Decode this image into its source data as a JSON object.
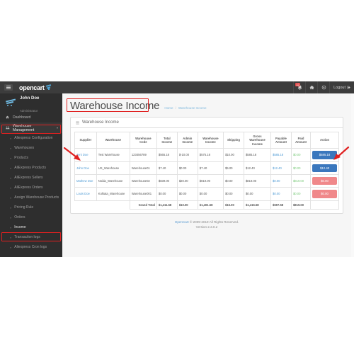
{
  "navbar": {
    "brand": "opencart",
    "toggle_name": "menu-toggle",
    "notifications_badge": "12",
    "logout_label": "Logout"
  },
  "sidebar": {
    "user_name": "John Doe",
    "user_role": "Administrator",
    "items": [
      {
        "label": "Dashboard",
        "icon": "dashboard-icon",
        "active": false
      },
      {
        "label": "Warehouse Management",
        "icon": "warehouse-icon",
        "active": true
      }
    ],
    "sub_items": [
      {
        "label": "Aliexpress Configuration"
      },
      {
        "label": "Warehouses"
      },
      {
        "label": "Products"
      },
      {
        "label": "AliExpress Products"
      },
      {
        "label": "AliExpress Sellers"
      },
      {
        "label": "AliExpress Orders"
      },
      {
        "label": "Assign Warehouse Products"
      },
      {
        "label": "Pricing Rule"
      },
      {
        "label": "Orders"
      },
      {
        "label": "Income"
      },
      {
        "label": "Transaction logs"
      },
      {
        "label": "Aliexpress Cron logs"
      }
    ],
    "current_sub": "Income"
  },
  "page": {
    "title": "Warehouse Income",
    "breadcrumb": [
      "Home",
      "Warehouse Income"
    ],
    "panel_title": "Warehouse Income"
  },
  "table": {
    "columns": [
      "Supplier",
      "Warehouse",
      "Warehouse Code",
      "Total Income",
      "Admin Income",
      "Warehouse Income",
      "Shipping",
      "Gross Warehouse Income",
      "Payable Amount",
      "Paid Amount",
      "Action"
    ],
    "rows": [
      {
        "supplier": "Jeni Doe",
        "warehouse": "Test Warehouse",
        "code": "123456789",
        "total_income": "$565.18",
        "admin_income": "$-10.00",
        "warehouse_income": "$575.18",
        "shipping": "$10.00",
        "gross_warehouse_income": "$585.18",
        "payable_amount": "$585.18",
        "paid_amount": "$0.00",
        "action_label": "$585.18",
        "action_style": "blue"
      },
      {
        "supplier": "John Doe",
        "warehouse": "US_Warehouse",
        "code": "Warehouse01",
        "total_income": "$7.40",
        "admin_income": "$0.00",
        "warehouse_income": "$7.40",
        "shipping": "$5.00",
        "gross_warehouse_income": "$12.40",
        "payable_amount": "$12.40",
        "paid_amount": "$0.00",
        "action_label": "$12.40",
        "action_style": "blue"
      },
      {
        "supplier": "Mathew Doe",
        "warehouse": "Noida_Warehouse",
        "code": "Warehouse02",
        "total_income": "$839.00",
        "admin_income": "$20.00",
        "warehouse_income": "$819.00",
        "shipping": "$0.00",
        "gross_warehouse_income": "$819.00",
        "payable_amount": "$0.00",
        "paid_amount": "$819.00",
        "action_label": "$0.00",
        "action_style": "red"
      },
      {
        "supplier": "Louis Doe",
        "warehouse": "Kolkata_Warehouse",
        "code": "Warehouse001",
        "total_income": "$0.00",
        "admin_income": "$0.00",
        "warehouse_income": "$0.00",
        "shipping": "$0.00",
        "gross_warehouse_income": "$0.00",
        "payable_amount": "$0.00",
        "paid_amount": "$0.00",
        "action_label": "$0.00",
        "action_style": "red"
      }
    ],
    "total_row": {
      "label": "Grand Total",
      "total_income": "$1,411.58",
      "admin_income": "$10.00",
      "warehouse_income": "$1,401.58",
      "shipping": "$15.00",
      "gross_warehouse_income": "$1,416.58",
      "payable_amount": "$597.58",
      "paid_amount": "$819.00"
    }
  },
  "footer": {
    "brand": "OpenCart",
    "copyright": "© 2009-2019 All Rights Reserved.",
    "version": "Version 2.3.0.2"
  },
  "colors": {
    "accent_blue": "#3a77bd",
    "link_blue": "#4e9ad4",
    "paid_green": "#79c979",
    "action_red": "#f0888a",
    "annotation_red": "#e02020",
    "sidebar_bg": "#2e2e2e",
    "navbar_bg": "#3c3c3c"
  }
}
